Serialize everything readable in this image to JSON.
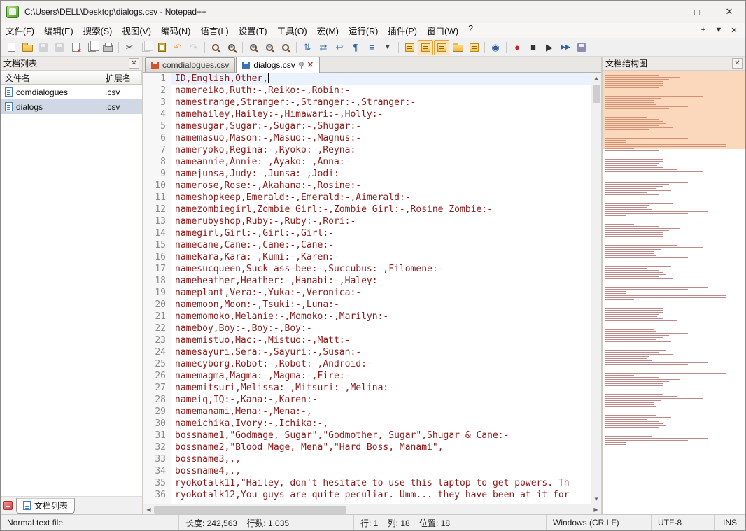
{
  "colors": {
    "editor_text": "#8b1a1a",
    "current_line": "#e9f2fd",
    "map_viewport": "rgba(246,157,86,0.40)",
    "selected_row": "#cfd8e4"
  },
  "window": {
    "title": "C:\\Users\\DELL\\Desktop\\dialogs.csv - Notepad++",
    "controls": {
      "minimize": "—",
      "maximize": "□",
      "close": "✕"
    }
  },
  "menu": {
    "items": [
      "文件(F)",
      "编辑(E)",
      "搜索(S)",
      "视图(V)",
      "编码(N)",
      "语言(L)",
      "设置(T)",
      "工具(O)",
      "宏(M)",
      "运行(R)",
      "插件(P)",
      "窗口(W)",
      "?"
    ],
    "right": [
      "+",
      "▼",
      "✕"
    ]
  },
  "toolbar": {
    "icons": [
      {
        "name": "new-file",
        "kind": "page"
      },
      {
        "name": "open-file",
        "kind": "folder"
      },
      {
        "name": "save-file",
        "kind": "floppy",
        "color": "#8fa7cb",
        "state": "disabled"
      },
      {
        "name": "save-all",
        "kind": "floppy",
        "color": "#8fa7cb",
        "state": "disabled"
      },
      {
        "name": "close-file",
        "kind": "page-x"
      },
      {
        "name": "close-all-files",
        "kind": "pages"
      },
      {
        "name": "print",
        "kind": "printer"
      },
      {
        "kind": "sep"
      },
      {
        "name": "cut",
        "kind": "glyph",
        "glyph": "✂",
        "color": "#555"
      },
      {
        "name": "copy",
        "kind": "pages",
        "state": "disabled"
      },
      {
        "name": "paste",
        "kind": "clipboard"
      },
      {
        "name": "undo",
        "kind": "glyph",
        "glyph": "↶",
        "color": "#e8972e"
      },
      {
        "name": "redo",
        "kind": "glyph",
        "glyph": "↷",
        "color": "#999",
        "state": "disabled"
      },
      {
        "kind": "sep"
      },
      {
        "name": "find",
        "kind": "mag"
      },
      {
        "name": "replace",
        "kind": "mag-plus"
      },
      {
        "kind": "sep"
      },
      {
        "name": "zoom-in",
        "kind": "mag-plus"
      },
      {
        "name": "zoom-out",
        "kind": "mag-minus"
      },
      {
        "name": "restore-zoom",
        "kind": "mag"
      },
      {
        "kind": "sep"
      },
      {
        "name": "sync-scroll-vertical",
        "kind": "glyph",
        "glyph": "⇅",
        "color": "#3b6ea5"
      },
      {
        "name": "sync-scroll-horizontal",
        "kind": "glyph",
        "glyph": "⇄",
        "color": "#3b6ea5"
      },
      {
        "name": "word-wrap",
        "kind": "glyph",
        "glyph": "↩",
        "color": "#3b6ea5"
      },
      {
        "name": "show-all-characters",
        "kind": "glyph",
        "glyph": "¶",
        "color": "#2e5fa3"
      },
      {
        "name": "indent-guide",
        "kind": "glyph",
        "glyph": "≡",
        "color": "#2e5fa3"
      },
      {
        "name": "chevron-dropdown",
        "kind": "glyph",
        "glyph": "▼",
        "color": "#444",
        "small": true
      },
      {
        "kind": "sep"
      },
      {
        "name": "function-list",
        "kind": "panel"
      },
      {
        "name": "document-map",
        "kind": "panel",
        "state": "active"
      },
      {
        "name": "document-list",
        "kind": "panel",
        "state": "active"
      },
      {
        "name": "folder-as-workspace",
        "kind": "folder"
      },
      {
        "name": "file-browser",
        "kind": "panel"
      },
      {
        "kind": "sep"
      },
      {
        "name": "document-monitor-eye",
        "kind": "glyph",
        "glyph": "◉",
        "color": "#2e5fa3"
      },
      {
        "kind": "sep"
      },
      {
        "name": "macro-record",
        "kind": "glyph",
        "glyph": "●",
        "color": "#cc2222"
      },
      {
        "name": "macro-stop",
        "kind": "glyph",
        "glyph": "■",
        "color": "#333"
      },
      {
        "name": "macro-play",
        "kind": "glyph",
        "glyph": "▶",
        "color": "#333"
      },
      {
        "name": "macro-run-multiple",
        "kind": "glyph",
        "glyph": "▶▶",
        "color": "#2e5fa3",
        "small": true
      },
      {
        "name": "macro-save",
        "kind": "floppy",
        "color": "#8a8fb0"
      }
    ]
  },
  "doc_list_panel": {
    "title": "文档列表",
    "columns": {
      "name": "文件名",
      "ext": "扩展名"
    },
    "rows": [
      {
        "name": "comdialogues",
        "ext": ".csv",
        "selected": false
      },
      {
        "name": "dialogs",
        "ext": ".csv",
        "selected": true
      }
    ],
    "bottom_tab": "文档列表"
  },
  "tabs": [
    {
      "label": "comdialogues.csv",
      "active": false,
      "modified": true
    },
    {
      "label": "dialogs.csv",
      "active": true,
      "modified": false
    }
  ],
  "editor": {
    "caret_line": 1,
    "lines": [
      "ID,English,Other,",
      "namereiko,Ruth:-,Reiko:-,Robin:-",
      "namestrange,Stranger:-,Stranger:-,Stranger:-",
      "namehailey,Hailey:-,Himawari:-,Holly:-",
      "namesugar,Sugar:-,Sugar:-,Shugar:-",
      "namemasuo,Mason:-,Masuo:-,Magnus:-",
      "nameryoko,Regina:-,Ryoko:-,Reyna:-",
      "nameannie,Annie:-,Ayako:-,Anna:-",
      "namejunsa,Judy:-,Junsa:-,Jodi:-",
      "namerose,Rose:-,Akahana:-,Rosine:-",
      "nameshopkeep,Emerald:-,Emerald:-,Aimerald:-",
      "namezombiegirl,Zombie Girl:-,Zombie Girl:-,Rosine Zombie:-",
      "namerubyshop,Ruby:-,Ruby:-,Rori:-",
      "namegirl,Girl:-,Girl:-,Girl:-",
      "namecane,Cane:-,Cane:-,Cane:-",
      "namekara,Kara:-,Kumi:-,Karen:-",
      "namesucqueen,Suck-ass-bee:-,Succubus:-,Filomene:-",
      "nameheather,Heather:-,Hanabi:-,Haley:-",
      "nameplant,Vera:-,Yuka:-,Veronica:-",
      "namemoon,Moon:-,Tsuki:-,Luna:-",
      "namemomoko,Melanie:-,Momoko:-,Marilyn:-",
      "nameboy,Boy:-,Boy:-,Boy:-",
      "namemistuo,Mac:-,Mistuo:-,Matt:-",
      "namesayuri,Sera:-,Sayuri:-,Susan:-",
      "namecyborg,Robot:-,Robot:-,Android:-",
      "namemagma,Magma:-,Magma:-,Fire:-",
      "namemitsuri,Melissa:-,Mitsuri:-,Melina:-",
      "nameiq,IQ:-,Kana:-,Karen:-",
      "namemanami,Mena:-,Mena:-,",
      "nameichika,Ivory:-,Ichika:-,",
      "bossname1,\"Godmage, Sugar\",\"Godmother, Sugar\",Shugar & Cane:-",
      "bossname2,\"Blood Mage, Mena\",\"Hard Boss, Manami\",",
      "bossname3,,,",
      "bossname4,,,",
      "ryokotalk11,\"Hailey, don't hesitate to use this laptop to get powers. Th",
      "ryokotalk12,You guys are quite peculiar. Umm... they have been at it for"
    ]
  },
  "doc_map_panel": {
    "title": "文档结构图"
  },
  "status_bar": {
    "doc_type": "Normal text file",
    "length_info": "长度: 242,563    行数: 1,035",
    "cursor_info": "行: 1    列: 18    位置: 18",
    "eol": "Windows (CR LF)",
    "encoding": "UTF-8",
    "insert_mode": "INS"
  }
}
